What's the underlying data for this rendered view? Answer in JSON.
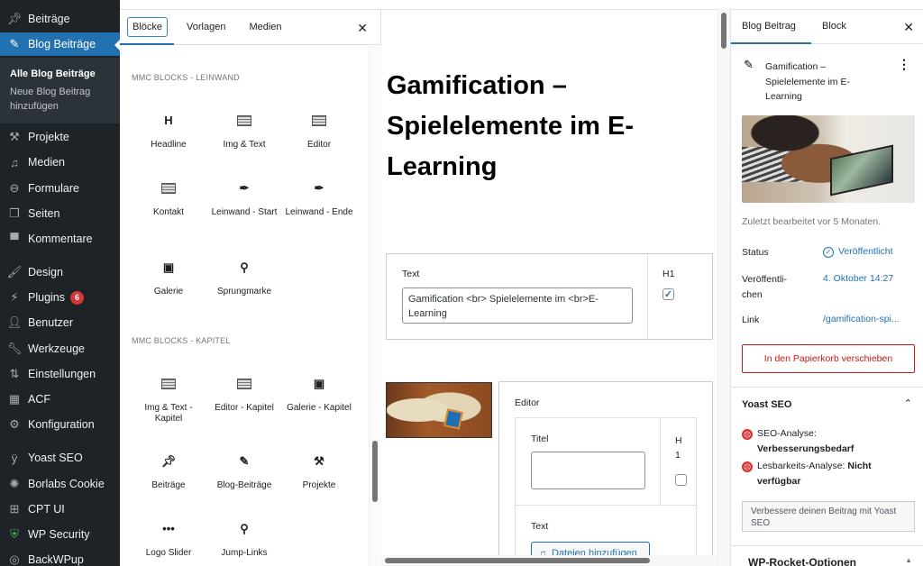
{
  "admin_menu": {
    "items": [
      {
        "label": "Beiträge",
        "icon": "pin-icon"
      },
      {
        "label": "Blog Beiträge",
        "icon": "edit-post-icon",
        "active": true
      },
      {
        "label": "Projekte",
        "icon": "hammer-icon"
      },
      {
        "label": "Medien",
        "icon": "media-icon"
      },
      {
        "label": "Formulare",
        "icon": "forms-icon"
      },
      {
        "label": "Seiten",
        "icon": "pages-icon"
      },
      {
        "label": "Kommentare",
        "icon": "comment-icon"
      },
      {
        "label": "Design",
        "icon": "brush-icon"
      },
      {
        "label": "Plugins",
        "icon": "plugin-icon",
        "badge": "6"
      },
      {
        "label": "Benutzer",
        "icon": "user-icon"
      },
      {
        "label": "Werkzeuge",
        "icon": "wrench-icon"
      },
      {
        "label": "Einstellungen",
        "icon": "settings-sliders-icon"
      },
      {
        "label": "ACF",
        "icon": "acf-icon"
      },
      {
        "label": "Konfiguration",
        "icon": "gear-icon"
      },
      {
        "label": "Yoast SEO",
        "icon": "yoast-icon"
      },
      {
        "label": "Borlabs Cookie",
        "icon": "cookie-icon"
      },
      {
        "label": "CPT UI",
        "icon": "grid-icon"
      },
      {
        "label": "WP Security",
        "icon": "shield-icon"
      },
      {
        "label": "BackWPup",
        "icon": "backup-icon"
      }
    ],
    "submenu": {
      "current": "Alle Blog Beiträge",
      "other": "Neue Blog Beitrag hinzufügen"
    }
  },
  "inserter": {
    "tabs": [
      "Blöcke",
      "Vorlagen",
      "Medien"
    ],
    "active_tab": "Blöcke",
    "close_icon": "close-icon",
    "categories": [
      {
        "title": "MMC BLOCKS - LEINWAND",
        "blocks": [
          {
            "label": "Headline",
            "icon": "heading-icon"
          },
          {
            "label": "Img & Text",
            "icon": "keyboard-icon"
          },
          {
            "label": "Editor",
            "icon": "keyboard-icon"
          },
          {
            "label": "Kontakt",
            "icon": "keyboard-icon"
          },
          {
            "label": "Leinwand - Start",
            "icon": "eyedropper-icon"
          },
          {
            "label": "Leinwand - Ende",
            "icon": "eyedropper-icon"
          },
          {
            "label": "Galerie",
            "icon": "gallery-icon"
          },
          {
            "label": "Sprungmarke",
            "icon": "location-icon"
          }
        ]
      },
      {
        "title": "MMC BLOCKS - KAPITEL",
        "blocks": [
          {
            "label": "Img & Text - Kapitel",
            "icon": "keyboard-icon"
          },
          {
            "label": "Editor - Kapitel",
            "icon": "keyboard-icon"
          },
          {
            "label": "Galerie - Kapitel",
            "icon": "gallery-icon"
          },
          {
            "label": "Beiträge",
            "icon": "pin-icon"
          },
          {
            "label": "Blog-Beiträge",
            "icon": "edit-post-icon"
          },
          {
            "label": "Projekte",
            "icon": "hammer-icon"
          },
          {
            "label": "Logo Slider",
            "icon": "ellipsis-icon"
          },
          {
            "label": "Jump-Links",
            "icon": "location-icon"
          }
        ]
      }
    ]
  },
  "editor": {
    "post_title": "Gamification  – Spielelemente im E-Learning",
    "headline_block": {
      "text_label": "Text",
      "text_value": "Gamification <br>  Spielelemente im <br>E-Learning",
      "h1_label": "H1",
      "h1_checked": true
    },
    "editor_block": {
      "label": "Editor",
      "titel_label": "Titel",
      "titel_value": "",
      "h1_label": "H 1",
      "h1_checked": false,
      "text_label": "Text",
      "add_files_button": "Dateien hinzufügen"
    }
  },
  "settings": {
    "tabs": [
      "Blog Beitrag",
      "Block"
    ],
    "active_tab": "Blog Beitrag",
    "post_title": "Gamification  – Spielelemente im E-Learning",
    "last_edited": "Zuletzt bearbeitet vor 5 Monaten.",
    "status_label": "Status",
    "status_value": "Veröffentlicht",
    "publish_label": "Veröffentli-chen",
    "publish_value": "4. Oktober 14:27",
    "link_label": "Link",
    "link_value": "/gamification-spi...",
    "trash_button": "In den Papierkorb verschieben",
    "yoast": {
      "title": "Yoast SEO",
      "seo_label": "SEO-Analyse:",
      "seo_value": "Verbesserungsbedarf",
      "readability_label": "Lesbarkeits-Analyse:",
      "readability_value": "Nicht verfügbar",
      "improve_button": "Verbessere deinen Beitrag mit Yoast SEO"
    },
    "wp_rocket_title": "WP-Rocket-Optionen"
  },
  "colors": {
    "admin_bg": "#1d2327",
    "admin_active": "#2271b1",
    "accent": "#2271b1",
    "danger": "#cc1818",
    "badge": "#d63638"
  }
}
